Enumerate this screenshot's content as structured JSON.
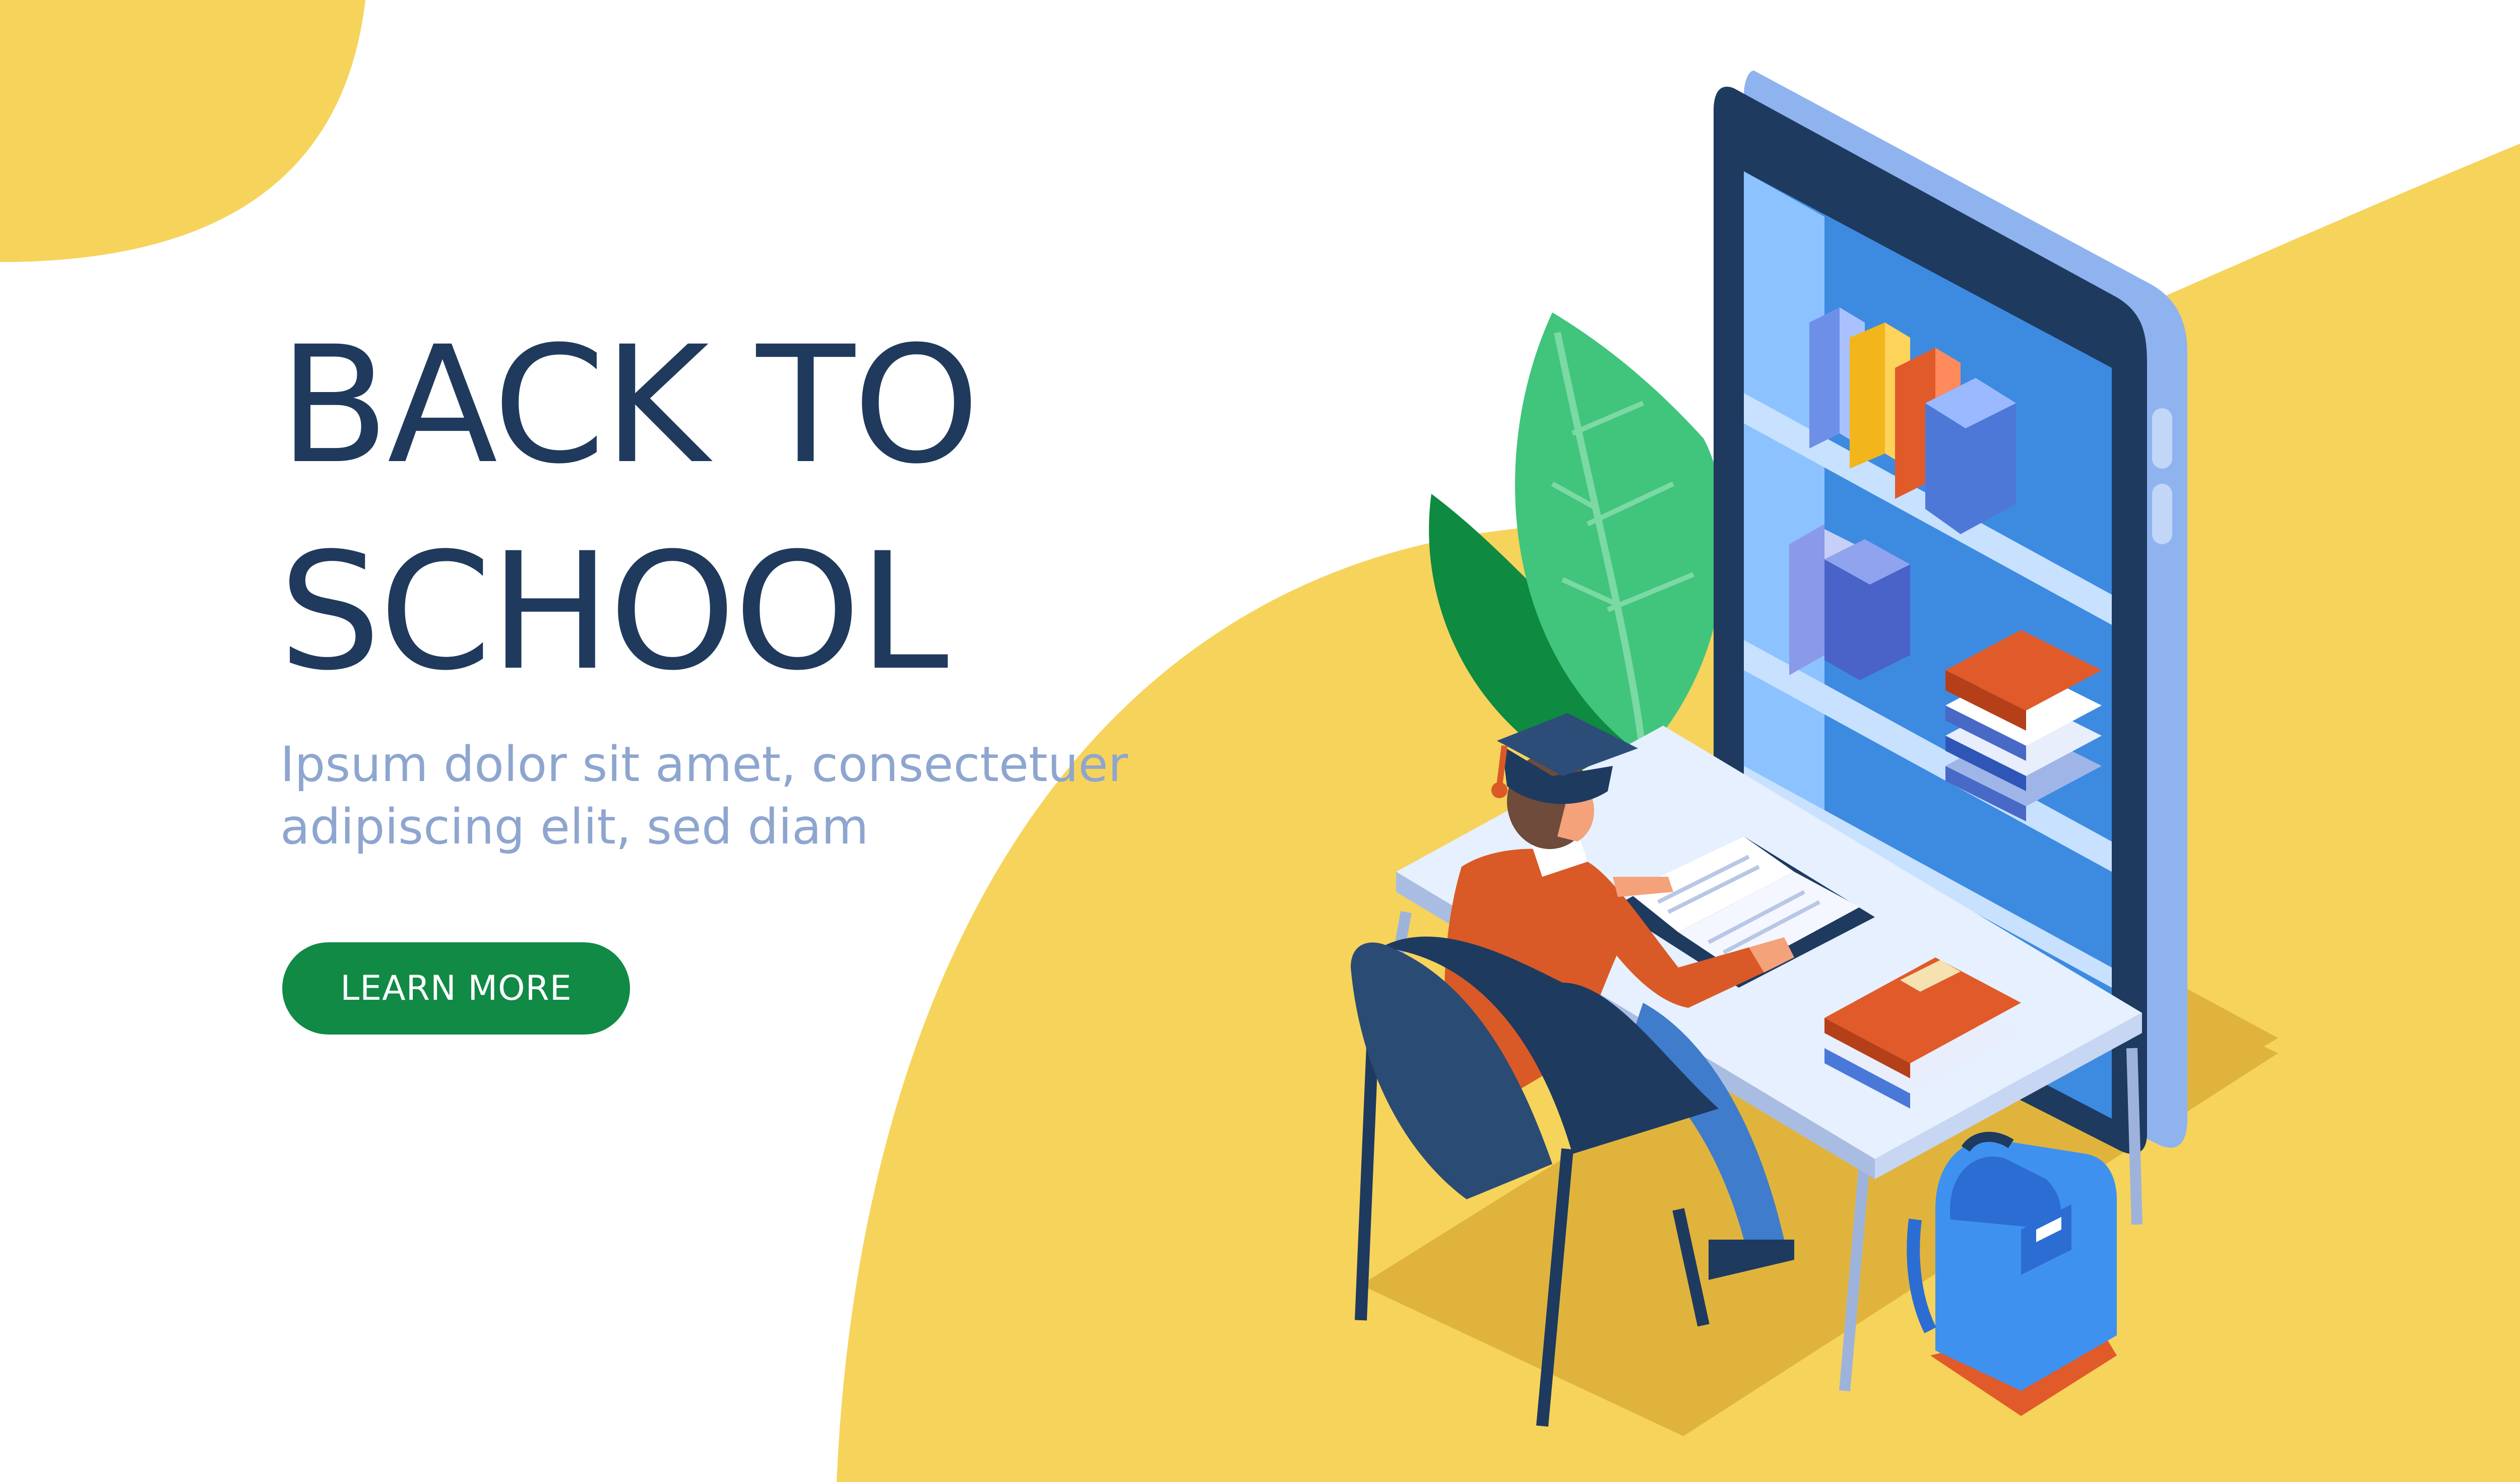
{
  "hero": {
    "title_line1": "BACK TO",
    "title_line2": "SCHOOL",
    "subtitle_line1": "Ipsum dolor sit amet, consectetuer",
    "subtitle_line2": "adipiscing elit, sed diam",
    "cta_label": "LEARN MORE"
  },
  "colors": {
    "background": "#ffffff",
    "accent_yellow": "#f6d35b",
    "title_text": "#1f3a5c",
    "subtitle_text": "#8ea6cf",
    "button": "#108a45",
    "button_text": "#ffffff"
  },
  "illustration": {
    "scene": "isometric student reading at a desk beside a giant smartphone with bookshelves",
    "icons": [
      "plant-icon",
      "smartphone-icon",
      "bookshelf-icon",
      "book-icon",
      "student-icon",
      "graduation-cap-icon",
      "desk-icon",
      "chair-icon",
      "backpack-icon"
    ]
  }
}
